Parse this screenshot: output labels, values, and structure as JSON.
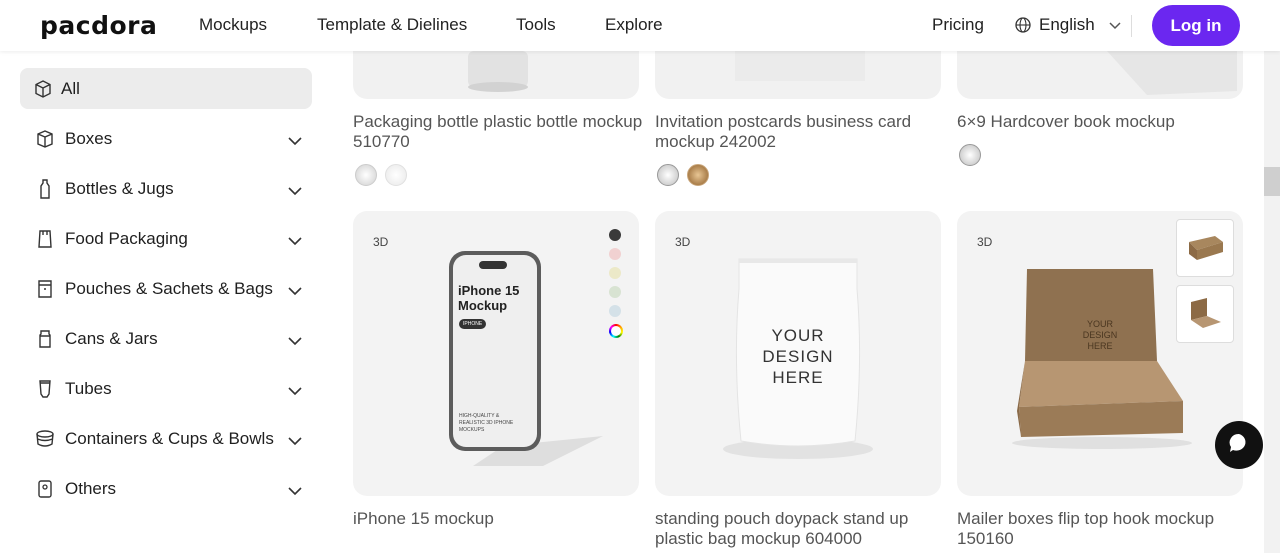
{
  "header": {
    "logo": "pacdora",
    "nav": [
      "Mockups",
      "Template & Dielines",
      "Tools",
      "Explore"
    ],
    "pricing": "Pricing",
    "language": "English",
    "login": "Log in"
  },
  "sidebar": {
    "all": "All",
    "items": [
      {
        "label": "Boxes",
        "icon": "box-icon"
      },
      {
        "label": "Bottles & Jugs",
        "icon": "bottle-icon"
      },
      {
        "label": "Food Packaging",
        "icon": "food-packaging-icon"
      },
      {
        "label": "Pouches & Sachets & Bags",
        "icon": "pouch-icon"
      },
      {
        "label": "Cans & Jars",
        "icon": "jar-icon"
      },
      {
        "label": "Tubes",
        "icon": "tube-icon"
      },
      {
        "label": "Containers & Cups & Bowls",
        "icon": "bowl-icon"
      },
      {
        "label": "Others",
        "icon": "others-icon"
      }
    ]
  },
  "top_cards": [
    {
      "title": "Packaging bottle plastic bottle mockup 510770"
    },
    {
      "title": "Invitation postcards business card mockup 242002"
    },
    {
      "title": "6×9 Hardcover book mockup"
    }
  ],
  "cards": [
    {
      "title": "iPhone 15 mockup",
      "tag": "3D",
      "phone_line1": "iPhone 15",
      "phone_line2": "Mockup",
      "phone_badge": "IPHONE",
      "phone_small": "HIGH-QUALITY & REALISTIC 3D IPHONE MOCKUPS"
    },
    {
      "title": "standing pouch doypack stand up plastic bag mockup 604000",
      "tag": "3D",
      "pouch_text": "YOUR DESIGN HERE"
    },
    {
      "title": "Mailer boxes flip top hook mockup 150160",
      "tag": "3D",
      "box_text": "YOUR DESIGN HERE"
    }
  ],
  "colors": {
    "accent": "#6b27f0",
    "phone_swatches": [
      "#3a3a3a",
      "#f1d1d1",
      "#ece9c8",
      "#d8e3d2",
      "#d4e1e8",
      "rainbow"
    ],
    "bottle_swatches": [
      "#e6e6e6",
      "#ffffff"
    ],
    "card_swatches": [
      "#e6e6e6",
      "#b88a4c"
    ],
    "book_swatches": [
      "#e6e6e6"
    ]
  }
}
